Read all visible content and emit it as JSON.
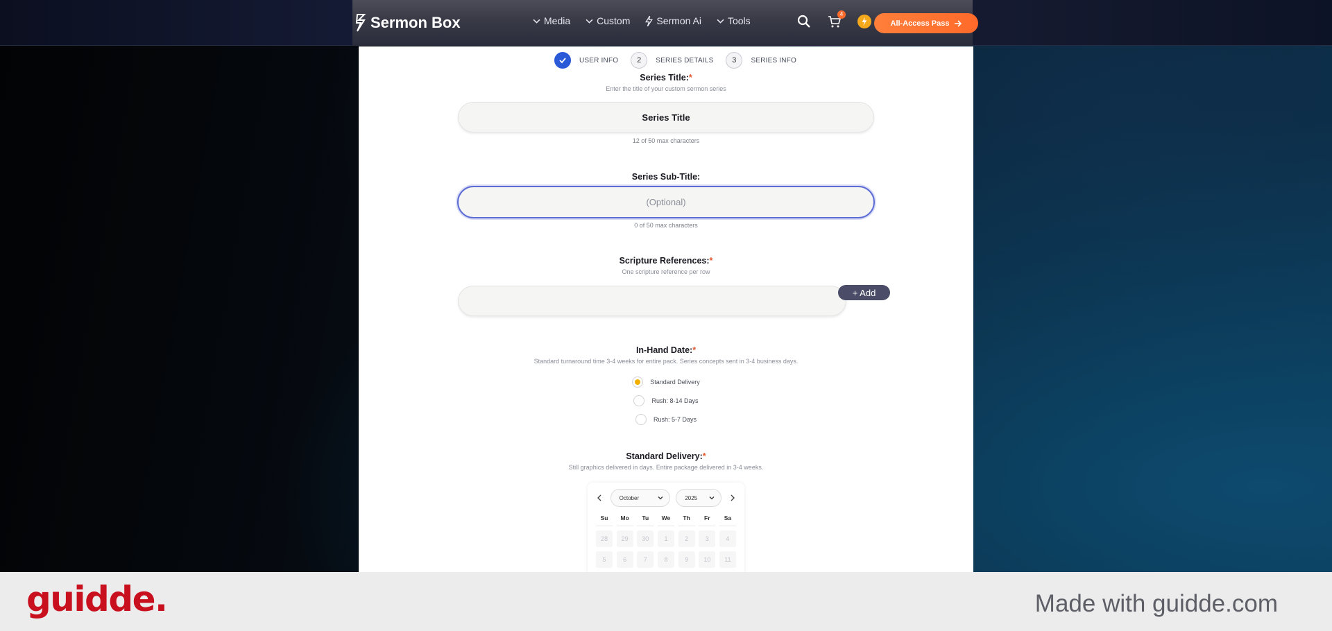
{
  "header": {
    "brand": "Sermon Box",
    "menu": [
      {
        "label": "Media",
        "icon": "chevron-down-icon"
      },
      {
        "label": "Custom",
        "icon": "chevron-down-icon"
      },
      {
        "label": "Sermon Ai",
        "icon": "lightning-icon"
      },
      {
        "label": "Tools",
        "icon": "chevron-down-icon"
      }
    ],
    "cart_count": "4",
    "pass_button": "All-Access Pass"
  },
  "stepper": {
    "steps": [
      {
        "num": "",
        "label": "USER INFO",
        "done": true
      },
      {
        "num": "2",
        "label": "SERIES DETAILS",
        "done": false
      },
      {
        "num": "3",
        "label": "SERIES INFO",
        "done": false
      }
    ]
  },
  "form": {
    "series_title": {
      "label": "Series Title:",
      "required": "*",
      "hint": "Enter the title of your custom sermon series",
      "value": "Series Title",
      "counter": "12 of 50 max characters"
    },
    "series_subtitle": {
      "label": "Series Sub-Title:",
      "placeholder": "(Optional)",
      "counter": "0 of 50 max characters"
    },
    "scripture": {
      "label": "Scripture References:",
      "required": "*",
      "hint": "One scripture reference per row",
      "value": "",
      "add_button": "+ Add"
    },
    "in_hand_date": {
      "label": "In-Hand Date:",
      "required": "*",
      "hint": "Standard turnaround time 3-4 weeks for entire pack. Series concepts sent in 3-4 business days.",
      "options": [
        {
          "label": "Standard Delivery",
          "checked": true
        },
        {
          "label": "Rush: 8-14 Days",
          "checked": false
        },
        {
          "label": "Rush: 5-7 Days",
          "checked": false
        }
      ]
    },
    "standard_delivery": {
      "label": "Standard Delivery:",
      "required": "*",
      "hint": "Still graphics delivered in days. Entire package delivered in 3-4 weeks."
    }
  },
  "calendar": {
    "month": "October",
    "year": "2025",
    "weekdays": [
      "Su",
      "Mo",
      "Tu",
      "We",
      "Th",
      "Fr",
      "Sa"
    ],
    "weeks": [
      [
        "28",
        "29",
        "30",
        "1",
        "2",
        "3",
        "4"
      ],
      [
        "5",
        "6",
        "7",
        "8",
        "9",
        "10",
        "11"
      ]
    ]
  },
  "footer": {
    "logo": "guidde.",
    "tagline": "Made with guidde.com"
  },
  "colors": {
    "accent_blue": "#2a5ad8",
    "orange": "#ff6a2a",
    "radio_yellow": "#f2b100",
    "guidde_red": "#c8101e"
  }
}
